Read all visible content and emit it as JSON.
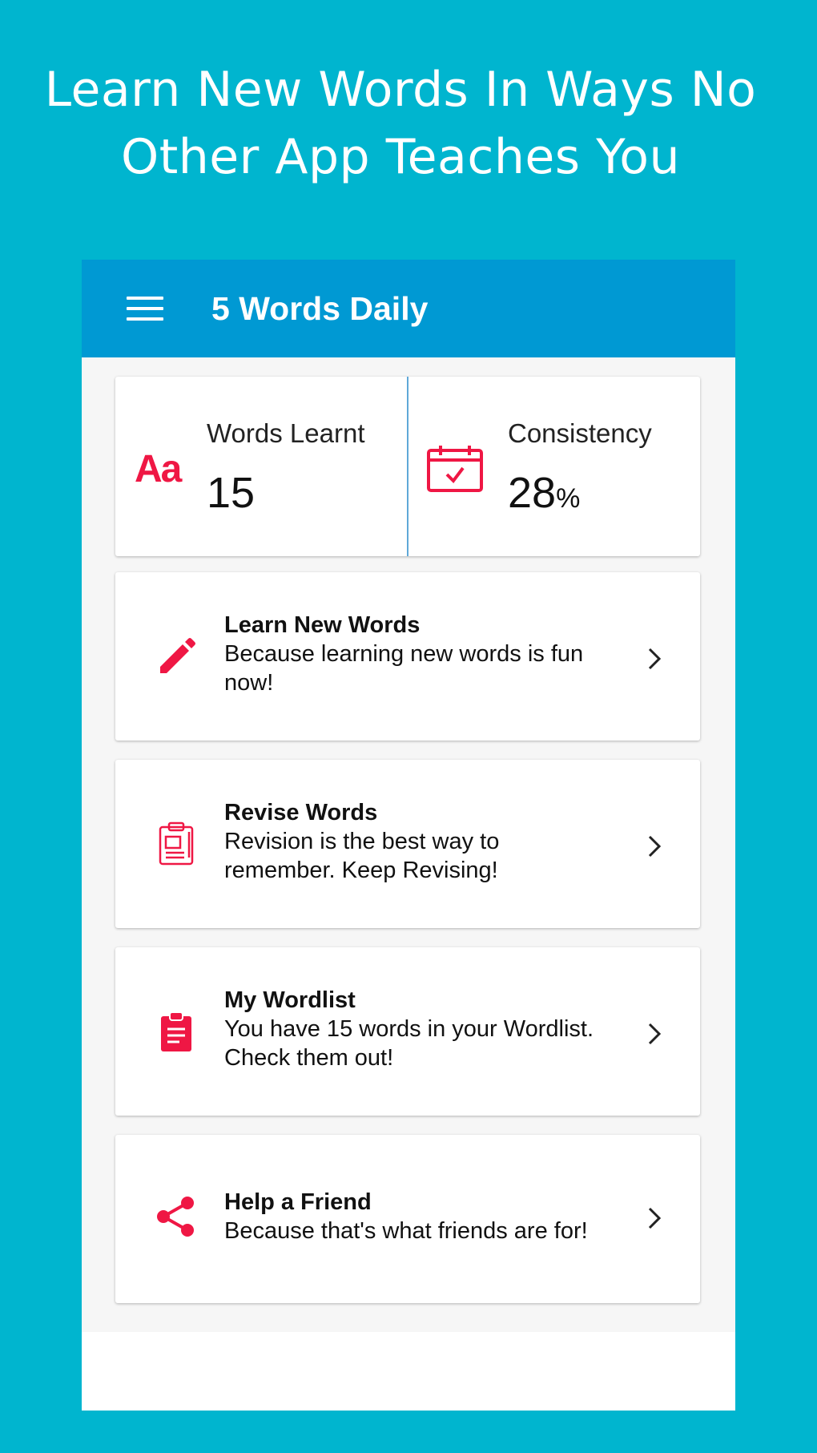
{
  "headline": {
    "line1": "Learn New Words In Ways No",
    "line2": "Other App Teaches You"
  },
  "appbar": {
    "menu_icon": "hamburger-menu-icon",
    "title": "5 Words Daily"
  },
  "stats": {
    "words_learnt": {
      "label": "Words Learnt",
      "value": "15",
      "icon": "text-aa-icon"
    },
    "consistency": {
      "label": "Consistency",
      "value": "28",
      "unit": "%",
      "icon": "calendar-check-icon"
    }
  },
  "menu": [
    {
      "title": "Learn New Words",
      "line1": "Because learning new words is fun",
      "line2": "now!",
      "icon": "pencil-icon"
    },
    {
      "title": "Revise Words",
      "line1": "Revision is the best way to",
      "line2": "remember. Keep Revising!",
      "icon": "clipboard-outline-icon"
    },
    {
      "title": "My Wordlist",
      "line1": "You have 15 words in your Wordlist.",
      "line2": "Check them out!",
      "icon": "clipboard-list-icon"
    },
    {
      "title": "Help a Friend",
      "line1": "Because that's what friends are for!",
      "line2": "",
      "icon": "share-icon"
    }
  ],
  "colors": {
    "background": "#00b5cf",
    "appbar": "#0099d3",
    "accent": "#ef1744"
  }
}
